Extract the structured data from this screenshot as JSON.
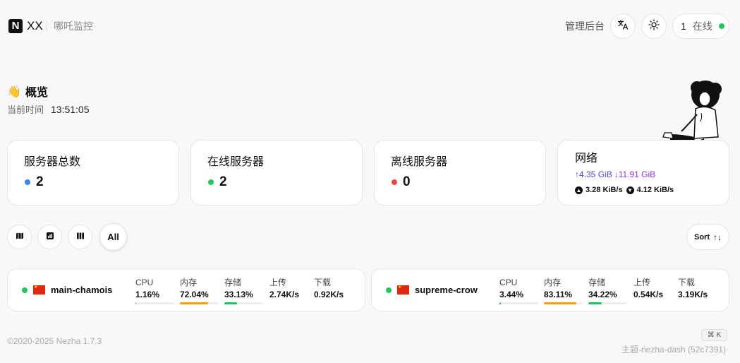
{
  "header": {
    "logo_letter": "N",
    "site_name": "XX",
    "site_subtitle": "哪吒监控",
    "admin_label": "管理后台",
    "online_count": "1",
    "online_label": "在线"
  },
  "overview": {
    "emoji": "👋",
    "title": "概览",
    "time_label": "当前时间",
    "time_value": "13:51:05"
  },
  "stats": [
    {
      "title": "服务器总数",
      "value": "2",
      "dot_color": "#3b82f6"
    },
    {
      "title": "在线服务器",
      "value": "2",
      "dot_color": "#22c55e"
    },
    {
      "title": "离线服务器",
      "value": "0",
      "dot_color": "#ef4444"
    }
  ],
  "network": {
    "title": "网络",
    "total_up": "↑4.35 GiB",
    "total_down": "↓11.91 GiB",
    "speed_up": "3.28 KiB/s",
    "speed_down": "4.12 KiB/s"
  },
  "toolbar": {
    "all_label": "All",
    "sort_label": "Sort",
    "sort_icon": "↑↓"
  },
  "metric_labels": {
    "cpu": "CPU",
    "mem": "内存",
    "disk": "存储",
    "up": "上传",
    "down": "下载"
  },
  "servers": [
    {
      "name": "main-chamois",
      "cpu": "1.16%",
      "cpu_pct": 1.16,
      "mem": "72.04%",
      "mem_pct": 72.04,
      "disk": "33.13%",
      "disk_pct": 33.13,
      "up": "2.74K/s",
      "down": "0.92K/s"
    },
    {
      "name": "supreme-crow",
      "cpu": "3.44%",
      "cpu_pct": 3.44,
      "mem": "83.11%",
      "mem_pct": 83.11,
      "disk": "34.22%",
      "disk_pct": 34.22,
      "up": "0.54K/s",
      "down": "3.19K/s"
    }
  ],
  "footer": {
    "copyright": "©2020-2025 Nezha 1.7.3",
    "shortcut": "⌘ K",
    "theme": "主题-nezha-dash (52c7391)"
  },
  "colors": {
    "cpu_bar": "#22c55e",
    "mem_bar": "#f59e0b",
    "disk_bar": "#22c55e",
    "online": "#22c55e"
  },
  "icons": {
    "translate": "translate-icon",
    "theme": "sun-icon",
    "map_view": "map-icon",
    "chart_view": "chart-icon",
    "grid_view": "columns-icon"
  }
}
